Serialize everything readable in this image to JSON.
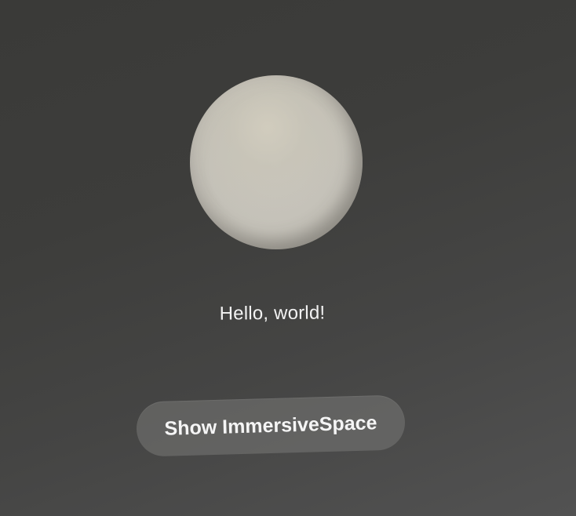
{
  "content": {
    "greeting": "Hello, world!",
    "model": "sphere"
  },
  "actions": {
    "show_immersive_label": "Show ImmersiveSpace"
  },
  "colors": {
    "background": "#3d3d3b",
    "sphere": "#c6c3ba",
    "text": "#f2f2f2",
    "button_fill": "#6e6e6c"
  }
}
